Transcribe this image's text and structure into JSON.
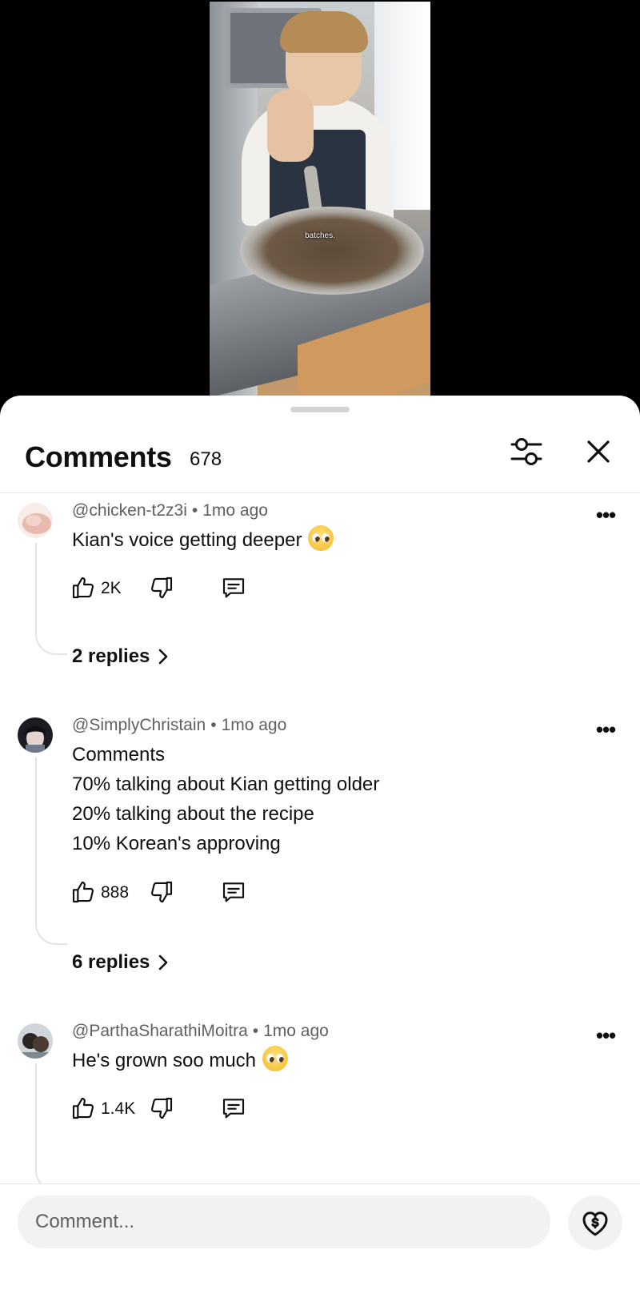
{
  "video": {
    "caption": "batches."
  },
  "comments_panel": {
    "title": "Comments",
    "count": "678",
    "filter_icon": "sliders-icon",
    "close_icon": "close-icon"
  },
  "comments": [
    {
      "author": "@chicken-t2z3i",
      "time": "1mo ago",
      "text": "Kian's voice getting deeper",
      "emoji": "pleading-face",
      "likes": "2K",
      "replies": "2 replies"
    },
    {
      "author": "@SimplyChristain",
      "time": "1mo ago",
      "lines": [
        "Comments",
        "70% talking about Kian getting older",
        "20% talking about the recipe",
        "10% Korean's approving"
      ],
      "likes": "888",
      "replies": "6 replies"
    },
    {
      "author": "@ParthaSharathiMoitra",
      "time": "1mo ago",
      "text": "He's grown soo much",
      "emoji": "pleading-face",
      "likes": "1.4K"
    }
  ],
  "composer": {
    "placeholder": "Comment...",
    "thanks_icon": "super-thanks-icon"
  },
  "colors": {
    "text": "#0f0f0f",
    "meta": "#606060",
    "input_bg": "#f2f2f2",
    "divider": "#e5e5e5"
  }
}
